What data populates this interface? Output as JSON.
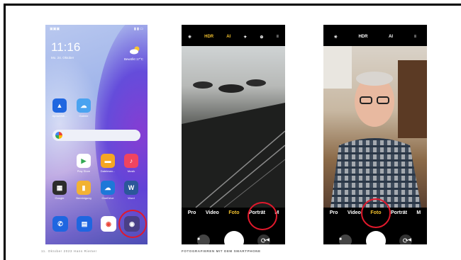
{
  "phone_home": {
    "status_left": "▣▣▣",
    "status_right": "▮ ▮ ▭",
    "clock": "11:16",
    "date": "Mo. 24. Oktober",
    "weather_text": "Bewölkt 17°C",
    "apps": [
      {
        "label": "ApowerMi...",
        "icon": "apowermirror-icon",
        "color": "#1f66e0",
        "glyph": "▲"
      },
      {
        "label": "Galerie",
        "icon": "gallery-icon",
        "color": "#4aa3f0",
        "glyph": "☁"
      },
      {
        "label": "Play Store",
        "icon": "play-store-icon",
        "color": "#ffffff",
        "glyph": "▶"
      },
      {
        "label": "Dateiman...",
        "icon": "file-manager-icon",
        "color": "#f5a623",
        "glyph": "▬"
      },
      {
        "label": "Musik",
        "icon": "music-icon",
        "color": "#f04460",
        "glyph": "♪"
      },
      {
        "label": "Google",
        "icon": "google-folder-icon",
        "color": "#2c2c2c",
        "glyph": "▦"
      },
      {
        "label": "Bereinigung",
        "icon": "cleaner-icon",
        "color": "#f2b233",
        "glyph": "▮"
      },
      {
        "label": "OneDrive",
        "icon": "onedrive-icon",
        "color": "#1d78d8",
        "glyph": "☁"
      },
      {
        "label": "Word",
        "icon": "word-icon",
        "color": "#2b579a",
        "glyph": "W"
      }
    ],
    "dock": [
      {
        "icon": "phone-icon",
        "color": "#1f66e0",
        "glyph": "✆"
      },
      {
        "icon": "messages-icon",
        "color": "#1f66e0",
        "glyph": "▤"
      },
      {
        "icon": "chrome-icon",
        "color": "#ffffff",
        "glyph": "◉"
      },
      {
        "icon": "camera-icon",
        "color": "#4a3f86",
        "glyph": "◉"
      }
    ]
  },
  "camera_back": {
    "top_icons": [
      "✳",
      "HDR",
      "AI",
      "✦",
      "⊕",
      "≡"
    ],
    "modes": [
      "Pro",
      "Video",
      "Foto",
      "Porträt",
      "M"
    ],
    "active_mode": "Foto",
    "switch_glyph": "⟳"
  },
  "camera_front": {
    "top_icons": [
      "✳",
      "HDR",
      "AI",
      "≡"
    ],
    "modes": [
      "Pro",
      "Video",
      "Foto",
      "Porträt",
      "M"
    ],
    "active_mode": "Foto",
    "switch_glyph": "⟳"
  },
  "navbar": [
    "■",
    "◉",
    "◀"
  ],
  "footer": {
    "left": "11. Oktober 2023   Hans Riemer",
    "center": "FOTOGRAFIEREN MIT DEM SMARTPHONE"
  },
  "colors": {
    "highlight_ring": "#e1192c",
    "active_mode": "#f2c12e"
  }
}
